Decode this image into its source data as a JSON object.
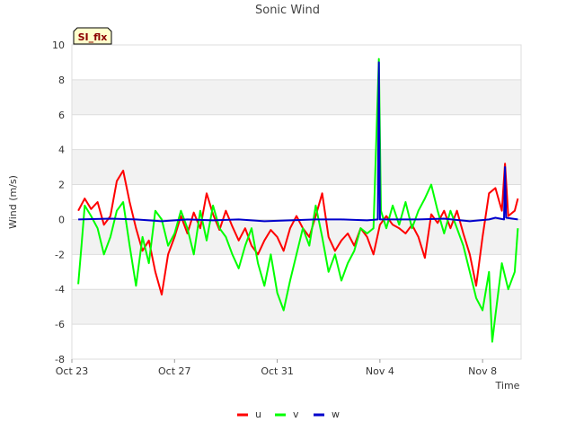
{
  "chart_data": {
    "type": "line",
    "title": "Sonic Wind",
    "xlabel": "Time",
    "ylabel": "Wind (m/s)",
    "badge": "SI_flx",
    "ylim": [
      -8,
      10
    ],
    "yticks": [
      -8,
      -6,
      -4,
      -2,
      0,
      2,
      4,
      6,
      8,
      10
    ],
    "xlim": [
      "2023-10-23",
      "2023-11-09T12:00"
    ],
    "xticks": [
      {
        "date": "2023-10-23",
        "label": "Oct 23"
      },
      {
        "date": "2023-10-27",
        "label": "Oct 27"
      },
      {
        "date": "2023-10-31",
        "label": "Oct 31"
      },
      {
        "date": "2023-11-04",
        "label": "Nov 4"
      },
      {
        "date": "2023-11-08",
        "label": "Nov 8"
      }
    ],
    "grid": "horizontal bands",
    "legend_position": "bottom",
    "series": [
      {
        "name": "u",
        "color": "#ff0000",
        "points": [
          [
            "2023-10-23T06:00",
            0.5
          ],
          [
            "2023-10-23T12:00",
            1.2
          ],
          [
            "2023-10-23T18:00",
            0.6
          ],
          [
            "2023-10-24T00:00",
            1.0
          ],
          [
            "2023-10-24T06:00",
            -0.3
          ],
          [
            "2023-10-24T12:00",
            0.2
          ],
          [
            "2023-10-24T18:00",
            2.2
          ],
          [
            "2023-10-25T00:00",
            2.8
          ],
          [
            "2023-10-25T06:00",
            1.0
          ],
          [
            "2023-10-25T12:00",
            -0.5
          ],
          [
            "2023-10-25T18:00",
            -1.8
          ],
          [
            "2023-10-26T00:00",
            -1.2
          ],
          [
            "2023-10-26T06:00",
            -3.0
          ],
          [
            "2023-10-26T12:00",
            -4.3
          ],
          [
            "2023-10-26T18:00",
            -2.0
          ],
          [
            "2023-10-27T00:00",
            -1.0
          ],
          [
            "2023-10-27T06:00",
            0.2
          ],
          [
            "2023-10-27T12:00",
            -0.8
          ],
          [
            "2023-10-27T18:00",
            0.4
          ],
          [
            "2023-10-28T00:00",
            -0.5
          ],
          [
            "2023-10-28T06:00",
            1.5
          ],
          [
            "2023-10-28T12:00",
            0.3
          ],
          [
            "2023-10-28T18:00",
            -0.6
          ],
          [
            "2023-10-29T00:00",
            0.5
          ],
          [
            "2023-10-29T06:00",
            -0.4
          ],
          [
            "2023-10-29T12:00",
            -1.2
          ],
          [
            "2023-10-29T18:00",
            -0.5
          ],
          [
            "2023-10-30T00:00",
            -1.5
          ],
          [
            "2023-10-30T06:00",
            -2.0
          ],
          [
            "2023-10-30T12:00",
            -1.2
          ],
          [
            "2023-10-30T18:00",
            -0.6
          ],
          [
            "2023-10-31T00:00",
            -1.0
          ],
          [
            "2023-10-31T06:00",
            -1.8
          ],
          [
            "2023-10-31T12:00",
            -0.5
          ],
          [
            "2023-10-31T18:00",
            0.2
          ],
          [
            "2023-11-01T00:00",
            -0.5
          ],
          [
            "2023-11-01T06:00",
            -1.0
          ],
          [
            "2023-11-01T12:00",
            0.2
          ],
          [
            "2023-11-01T18:00",
            1.5
          ],
          [
            "2023-11-02T00:00",
            -1.0
          ],
          [
            "2023-11-02T06:00",
            -1.8
          ],
          [
            "2023-11-02T12:00",
            -1.2
          ],
          [
            "2023-11-02T18:00",
            -0.8
          ],
          [
            "2023-11-03T00:00",
            -1.5
          ],
          [
            "2023-11-03T06:00",
            -0.5
          ],
          [
            "2023-11-03T12:00",
            -1.0
          ],
          [
            "2023-11-03T18:00",
            -2.0
          ],
          [
            "2023-11-04T00:00",
            -0.3
          ],
          [
            "2023-11-04T06:00",
            0.2
          ],
          [
            "2023-11-04T12:00",
            -0.3
          ],
          [
            "2023-11-04T18:00",
            -0.5
          ],
          [
            "2023-11-05T00:00",
            -0.8
          ],
          [
            "2023-11-05T06:00",
            -0.3
          ],
          [
            "2023-11-05T12:00",
            -1.0
          ],
          [
            "2023-11-05T18:00",
            -2.2
          ],
          [
            "2023-11-06T00:00",
            0.3
          ],
          [
            "2023-11-06T06:00",
            -0.2
          ],
          [
            "2023-11-06T12:00",
            0.5
          ],
          [
            "2023-11-06T18:00",
            -0.5
          ],
          [
            "2023-11-07T00:00",
            0.5
          ],
          [
            "2023-11-07T06:00",
            -0.8
          ],
          [
            "2023-11-07T12:00",
            -2.0
          ],
          [
            "2023-11-07T18:00",
            -3.8
          ],
          [
            "2023-11-08T00:00",
            -1.0
          ],
          [
            "2023-11-08T06:00",
            1.5
          ],
          [
            "2023-11-08T12:00",
            1.8
          ],
          [
            "2023-11-08T18:00",
            0.5
          ],
          [
            "2023-11-08T21:00",
            3.2
          ],
          [
            "2023-11-09T00:00",
            0.2
          ],
          [
            "2023-11-09T06:00",
            0.5
          ],
          [
            "2023-11-09T09:00",
            1.2
          ]
        ]
      },
      {
        "name": "v",
        "color": "#00ff00",
        "points": [
          [
            "2023-10-23T06:00",
            -3.7
          ],
          [
            "2023-10-23T09:00",
            -1.5
          ],
          [
            "2023-10-23T12:00",
            0.8
          ],
          [
            "2023-10-23T18:00",
            0.2
          ],
          [
            "2023-10-24T00:00",
            -0.5
          ],
          [
            "2023-10-24T06:00",
            -2.0
          ],
          [
            "2023-10-24T12:00",
            -1.0
          ],
          [
            "2023-10-24T18:00",
            0.5
          ],
          [
            "2023-10-25T00:00",
            1.0
          ],
          [
            "2023-10-25T06:00",
            -1.5
          ],
          [
            "2023-10-25T12:00",
            -3.8
          ],
          [
            "2023-10-25T18:00",
            -1.0
          ],
          [
            "2023-10-26T00:00",
            -2.5
          ],
          [
            "2023-10-26T06:00",
            0.5
          ],
          [
            "2023-10-26T12:00",
            0.0
          ],
          [
            "2023-10-26T18:00",
            -1.5
          ],
          [
            "2023-10-27T00:00",
            -0.8
          ],
          [
            "2023-10-27T06:00",
            0.5
          ],
          [
            "2023-10-27T12:00",
            -0.5
          ],
          [
            "2023-10-27T18:00",
            -2.0
          ],
          [
            "2023-10-28T00:00",
            0.5
          ],
          [
            "2023-10-28T06:00",
            -1.2
          ],
          [
            "2023-10-28T12:00",
            0.8
          ],
          [
            "2023-10-28T18:00",
            -0.5
          ],
          [
            "2023-10-29T00:00",
            -1.0
          ],
          [
            "2023-10-29T06:00",
            -2.0
          ],
          [
            "2023-10-29T12:00",
            -2.8
          ],
          [
            "2023-10-29T18:00",
            -1.5
          ],
          [
            "2023-10-30T00:00",
            -0.5
          ],
          [
            "2023-10-30T06:00",
            -2.5
          ],
          [
            "2023-10-30T12:00",
            -3.8
          ],
          [
            "2023-10-30T18:00",
            -2.0
          ],
          [
            "2023-10-31T00:00",
            -4.2
          ],
          [
            "2023-10-31T06:00",
            -5.2
          ],
          [
            "2023-10-31T12:00",
            -3.5
          ],
          [
            "2023-10-31T18:00",
            -2.0
          ],
          [
            "2023-11-01T00:00",
            -0.5
          ],
          [
            "2023-11-01T06:00",
            -1.5
          ],
          [
            "2023-11-01T12:00",
            0.8
          ],
          [
            "2023-11-01T18:00",
            -1.0
          ],
          [
            "2023-11-02T00:00",
            -3.0
          ],
          [
            "2023-11-02T06:00",
            -2.0
          ],
          [
            "2023-11-02T12:00",
            -3.5
          ],
          [
            "2023-11-02T18:00",
            -2.5
          ],
          [
            "2023-11-03T00:00",
            -1.8
          ],
          [
            "2023-11-03T06:00",
            -0.5
          ],
          [
            "2023-11-03T12:00",
            -0.8
          ],
          [
            "2023-11-03T18:00",
            -0.5
          ],
          [
            "2023-11-03T23:00",
            9.2
          ],
          [
            "2023-11-04T01:00",
            0.5
          ],
          [
            "2023-11-04T06:00",
            -0.5
          ],
          [
            "2023-11-04T12:00",
            0.8
          ],
          [
            "2023-11-04T18:00",
            -0.3
          ],
          [
            "2023-11-05T00:00",
            1.0
          ],
          [
            "2023-11-05T06:00",
            -0.5
          ],
          [
            "2023-11-05T12:00",
            0.5
          ],
          [
            "2023-11-05T18:00",
            1.2
          ],
          [
            "2023-11-06T00:00",
            2.0
          ],
          [
            "2023-11-06T06:00",
            0.5
          ],
          [
            "2023-11-06T12:00",
            -0.8
          ],
          [
            "2023-11-06T18:00",
            0.5
          ],
          [
            "2023-11-07T00:00",
            -0.5
          ],
          [
            "2023-11-07T06:00",
            -1.5
          ],
          [
            "2023-11-07T12:00",
            -3.0
          ],
          [
            "2023-11-07T18:00",
            -4.5
          ],
          [
            "2023-11-08T00:00",
            -5.2
          ],
          [
            "2023-11-08T06:00",
            -3.0
          ],
          [
            "2023-11-08T09:00",
            -7.0
          ],
          [
            "2023-11-08T12:00",
            -5.5
          ],
          [
            "2023-11-08T18:00",
            -2.5
          ],
          [
            "2023-11-09T00:00",
            -4.0
          ],
          [
            "2023-11-09T06:00",
            -3.0
          ],
          [
            "2023-11-09T09:00",
            -0.5
          ]
        ]
      },
      {
        "name": "w",
        "color": "#0000cc",
        "points": [
          [
            "2023-10-23T06:00",
            0.0
          ],
          [
            "2023-10-24T12:00",
            0.05
          ],
          [
            "2023-10-25T12:00",
            0.0
          ],
          [
            "2023-10-26T12:00",
            -0.1
          ],
          [
            "2023-10-27T12:00",
            0.0
          ],
          [
            "2023-10-28T12:00",
            -0.05
          ],
          [
            "2023-10-29T12:00",
            0.0
          ],
          [
            "2023-10-30T12:00",
            -0.1
          ],
          [
            "2023-10-31T12:00",
            -0.05
          ],
          [
            "2023-11-01T12:00",
            0.0
          ],
          [
            "2023-11-02T12:00",
            0.0
          ],
          [
            "2023-11-03T12:00",
            -0.05
          ],
          [
            "2023-11-03T22:00",
            0.0
          ],
          [
            "2023-11-03T23:00",
            9.0
          ],
          [
            "2023-11-04T00:00",
            0.0
          ],
          [
            "2023-11-04T12:00",
            0.0
          ],
          [
            "2023-11-05T12:00",
            0.0
          ],
          [
            "2023-11-06T12:00",
            0.05
          ],
          [
            "2023-11-07T12:00",
            -0.1
          ],
          [
            "2023-11-08T06:00",
            0.0
          ],
          [
            "2023-11-08T12:00",
            0.1
          ],
          [
            "2023-11-08T20:00",
            0.0
          ],
          [
            "2023-11-08T21:00",
            3.0
          ],
          [
            "2023-11-08T22:00",
            0.1
          ],
          [
            "2023-11-09T09:00",
            0.0
          ]
        ]
      }
    ]
  }
}
